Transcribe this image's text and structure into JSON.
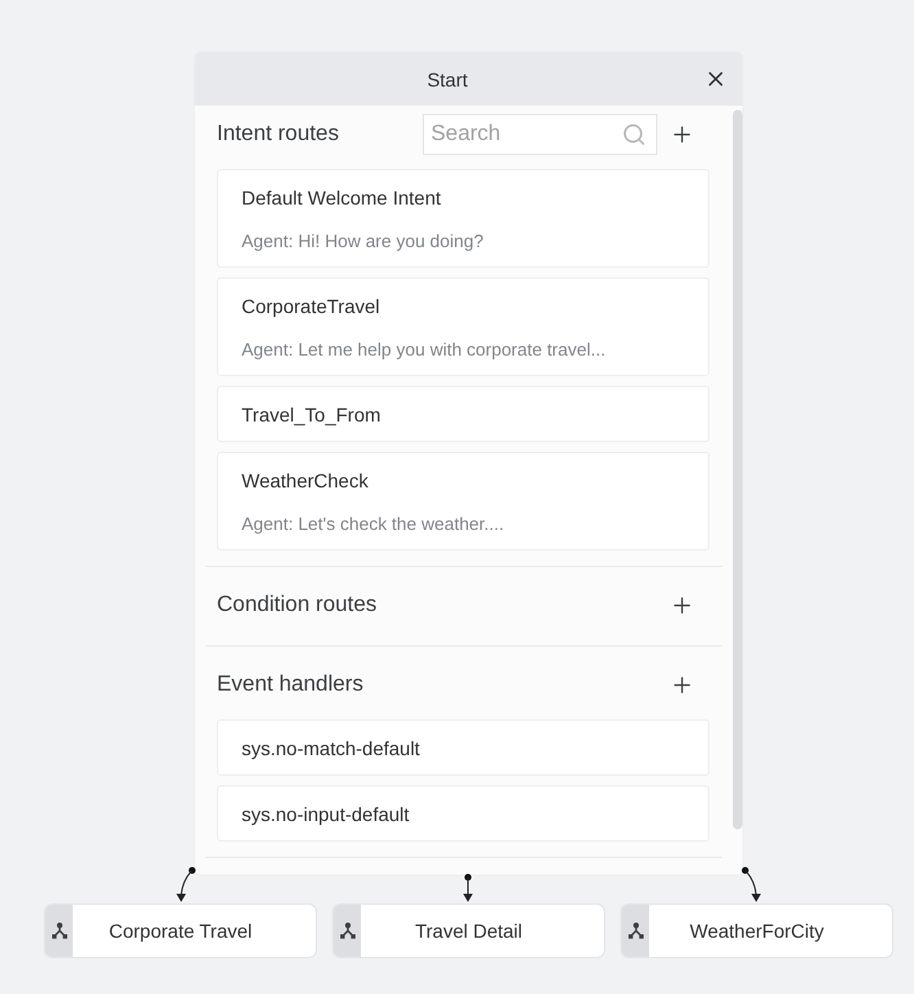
{
  "panel": {
    "title": "Start"
  },
  "sections": [
    {
      "title": "Intent routes",
      "search": {
        "placeholder": "Search"
      },
      "items": [
        {
          "name": "Default Welcome Intent",
          "response": "Agent: Hi! How are you doing?"
        },
        {
          "name": "CorporateTravel",
          "response": "Agent: Let me help you with corporate travel..."
        },
        {
          "name": "Travel_To_From"
        },
        {
          "name": "WeatherCheck",
          "response": "Agent: Let's check the weather...."
        }
      ]
    },
    {
      "title": "Condition routes"
    },
    {
      "title": "Event handlers",
      "items": [
        {
          "name": "sys.no-match-default"
        },
        {
          "name": "sys.no-input-default"
        }
      ]
    }
  ],
  "flow_nodes": [
    {
      "label": "Corporate Travel"
    },
    {
      "label": "Travel Detail"
    },
    {
      "label": "WeatherForCity"
    }
  ]
}
